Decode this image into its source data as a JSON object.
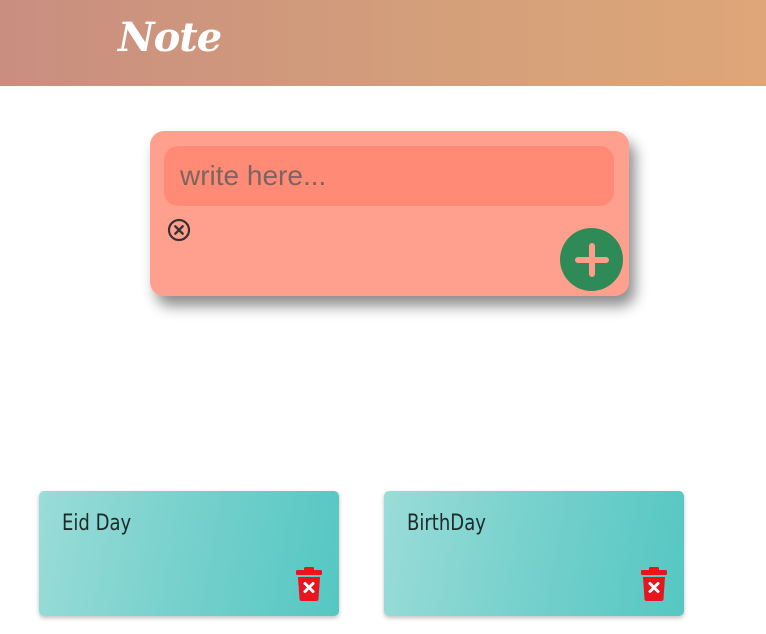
{
  "header": {
    "title": "Note"
  },
  "composer": {
    "placeholder": "write here...",
    "value": "",
    "icons": {
      "clear": "close-circle-icon",
      "add": "plus-icon"
    }
  },
  "notes": [
    {
      "text": "Eid Day",
      "delete_icon": "trash-icon"
    },
    {
      "text": "BirthDay",
      "delete_icon": "trash-icon"
    }
  ],
  "colors": {
    "header_gradient_start": "#c98e80",
    "header_gradient_end": "#dea679",
    "composer_bg": "#ffa08f",
    "input_bg": "#ff8b77",
    "add_button": "#2e8a56",
    "card_gradient_start": "#9adcd8",
    "card_gradient_end": "#55c7c2",
    "delete_icon": "#e8141e"
  }
}
